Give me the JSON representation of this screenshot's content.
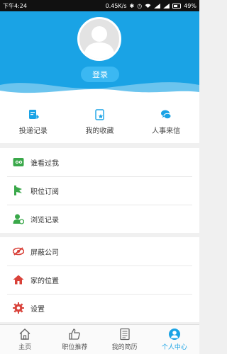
{
  "status_bar": {
    "time": "下午4:24",
    "speed": "0.45K/s",
    "battery": "49%"
  },
  "header": {
    "login_label": "登录"
  },
  "quick_actions": [
    {
      "label": "投递记录",
      "icon": "resume-send-icon"
    },
    {
      "label": "我的收藏",
      "icon": "favorite-icon"
    },
    {
      "label": "人事来信",
      "icon": "chat-icon"
    }
  ],
  "menu_group_1": [
    {
      "label": "谁看过我",
      "icon": "viewed-me-icon"
    },
    {
      "label": "职位订阅",
      "icon": "subscription-icon"
    },
    {
      "label": "浏览记录",
      "icon": "browse-history-icon"
    }
  ],
  "menu_group_2": [
    {
      "label": "屏蔽公司",
      "icon": "block-icon"
    },
    {
      "label": "家的位置",
      "icon": "home-icon"
    },
    {
      "label": "设置",
      "icon": "gear-icon"
    }
  ],
  "tab_bar": [
    {
      "label": "主页",
      "icon": "home-tab-icon"
    },
    {
      "label": "职位推荐",
      "icon": "thumbs-up-icon"
    },
    {
      "label": "我的简历",
      "icon": "resume-icon"
    },
    {
      "label": "个人中心",
      "icon": "person-icon",
      "active": true
    }
  ],
  "colors": {
    "accent": "#1aa3e5",
    "green": "#3aa84a",
    "red": "#d9423a"
  }
}
